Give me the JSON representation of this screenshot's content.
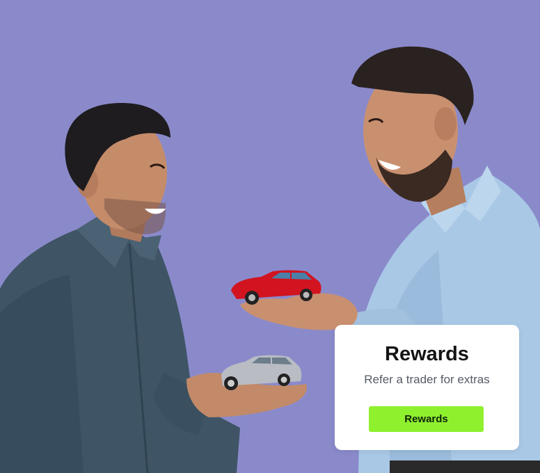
{
  "colors": {
    "background": "#8a8acb",
    "button_accent": "#8ff02e",
    "card_background": "#ffffff"
  },
  "illustration": {
    "subject": "two-men-exchanging-toy-cars",
    "red_car": "red-car-icon",
    "silver_car": "silver-car-icon"
  },
  "promo_card": {
    "title": "Rewards",
    "subtitle": "Refer a trader for extras",
    "button_label": "Rewards"
  }
}
